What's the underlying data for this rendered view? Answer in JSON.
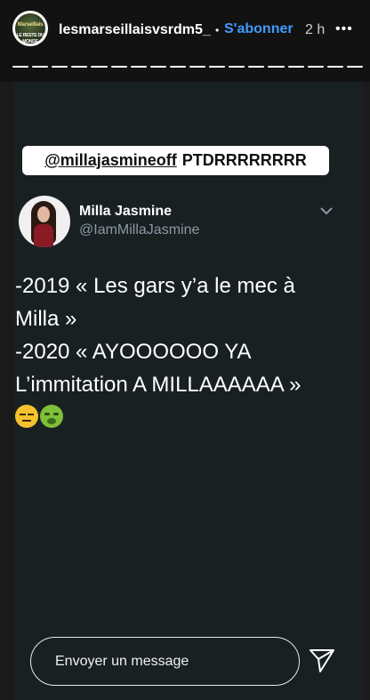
{
  "header": {
    "avatar_text_line1": "Marseillais",
    "avatar_text_line2": "LE RESTE DU MONDE",
    "username": "lesmarseillaisvsrdm5_",
    "separator": "•",
    "follow_label": "S'abonner",
    "time": "2 h",
    "more_label": "•••",
    "progress_segments": 18
  },
  "story": {
    "caption_mention": "@millajasmineoff",
    "caption_text": "PTDRRRRRRRR",
    "tweet": {
      "display_name": "Milla Jasmine",
      "handle": "@IamMillaJasmine",
      "text": "-2019 « Les gars y’a le mec à\nMilla »\n-2020 « AYOOOOOO YA\nL’immitation  A MILLAAAAAA »",
      "emojis": [
        "expressionless-face-emoji",
        "nauseated-face-emoji"
      ]
    }
  },
  "footer": {
    "message_placeholder": "Envoyer un message"
  },
  "colors": {
    "header_bg": "#121212",
    "story_bg": "#192022",
    "follow_accent": "#3f9bff",
    "handle_gray": "#8b98a5"
  }
}
